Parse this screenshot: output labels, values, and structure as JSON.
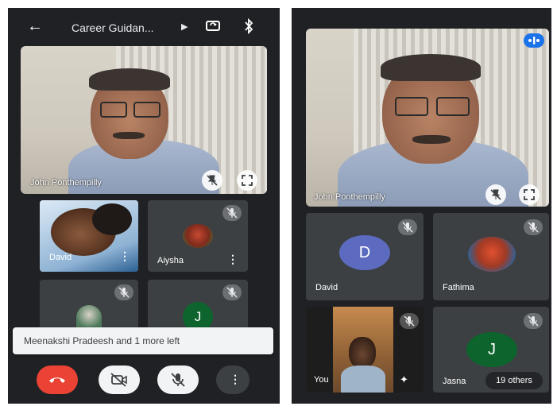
{
  "left_screen": {
    "title": "Career Guidan...",
    "main_speaker": {
      "name": "John Ponthempilly"
    },
    "tiles": [
      {
        "name": "David"
      },
      {
        "name": "Aiysha"
      },
      {
        "name": ""
      },
      {
        "avatar_letter": "J"
      }
    ],
    "toast": "Meenakshi Pradeesh and 1 more left",
    "controls": [
      "end-call",
      "camera-off",
      "mic-off",
      "more"
    ]
  },
  "right_screen": {
    "main_speaker": {
      "name": "John Ponthempilly"
    },
    "tiles": [
      {
        "name": "David",
        "avatar_letter": "D",
        "avatar_color": "#5c6bc0"
      },
      {
        "name": "Fathima"
      },
      {
        "name": "You"
      },
      {
        "name": "Jasna",
        "avatar_letter": "J",
        "avatar_color": "#0d652d"
      }
    ],
    "others_label": "19 others"
  },
  "colors": {
    "background": "#202124",
    "tile": "#3c4043",
    "end_call": "#ea4335",
    "accent_blue": "#1a73e8"
  }
}
